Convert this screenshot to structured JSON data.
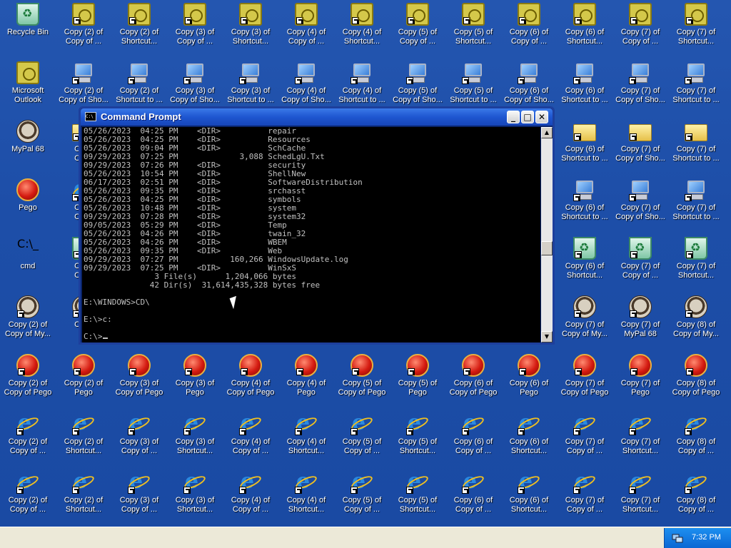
{
  "desktop": {
    "icons": [
      {
        "type": "recycle",
        "l1": "Recycle Bin",
        "l2": ""
      },
      {
        "type": "outlook",
        "l1": "Copy (2) of",
        "l2": "Copy of ..."
      },
      {
        "type": "outlook",
        "l1": "Copy (2) of",
        "l2": "Shortcut..."
      },
      {
        "type": "outlook",
        "l1": "Copy (3) of",
        "l2": "Copy of ..."
      },
      {
        "type": "outlook",
        "l1": "Copy (3) of",
        "l2": "Shortcut..."
      },
      {
        "type": "outlook",
        "l1": "Copy (4) of",
        "l2": "Copy of ..."
      },
      {
        "type": "outlook",
        "l1": "Copy (4) of",
        "l2": "Shortcut..."
      },
      {
        "type": "outlook",
        "l1": "Copy (5) of",
        "l2": "Copy of ..."
      },
      {
        "type": "outlook",
        "l1": "Copy (5) of",
        "l2": "Shortcut..."
      },
      {
        "type": "outlook",
        "l1": "Copy (6) of",
        "l2": "Copy of ..."
      },
      {
        "type": "outlook",
        "l1": "Copy (6) of",
        "l2": "Shortcut..."
      },
      {
        "type": "outlook",
        "l1": "Copy (7) of",
        "l2": "Copy of ..."
      },
      {
        "type": "outlook",
        "l1": "Copy (7) of",
        "l2": "Shortcut..."
      },
      {
        "type": "outlook",
        "l1": "Microsoft",
        "l2": "Outlook"
      },
      {
        "type": "computer",
        "l1": "Copy (2) of",
        "l2": "Copy of Sho..."
      },
      {
        "type": "computer",
        "l1": "Copy (2) of",
        "l2": "Shortcut to ..."
      },
      {
        "type": "computer",
        "l1": "Copy (3) of",
        "l2": "Copy of Sho..."
      },
      {
        "type": "computer",
        "l1": "Copy (3) of",
        "l2": "Shortcut to ..."
      },
      {
        "type": "computer",
        "l1": "Copy (4) of",
        "l2": "Copy of Sho..."
      },
      {
        "type": "computer",
        "l1": "Copy (4) of",
        "l2": "Shortcut to ..."
      },
      {
        "type": "computer",
        "l1": "Copy (5) of",
        "l2": "Copy of Sho..."
      },
      {
        "type": "computer",
        "l1": "Copy (5) of",
        "l2": "Shortcut to ..."
      },
      {
        "type": "computer",
        "l1": "Copy (6) of",
        "l2": "Copy of Sho..."
      },
      {
        "type": "computer",
        "l1": "Copy (6) of",
        "l2": "Shortcut to ..."
      },
      {
        "type": "computer",
        "l1": "Copy (7) of",
        "l2": "Copy of Sho..."
      },
      {
        "type": "computer",
        "l1": "Copy (7) of",
        "l2": "Shortcut to ..."
      },
      {
        "type": "raccoon",
        "l1": "MyPal 68",
        "l2": ""
      },
      {
        "type": "folder",
        "l1": "Copy",
        "l2": "Copy"
      },
      {
        "type": "folder",
        "l1": "Copy (6) of",
        "l2": "Shortcut to ..."
      },
      {
        "type": "folder",
        "l1": "Copy (7) of",
        "l2": "Copy of Sho..."
      },
      {
        "type": "folder",
        "l1": "Copy (7) of",
        "l2": "Shortcut to ..."
      },
      {
        "type": "pego",
        "l1": "Pego",
        "l2": ""
      },
      {
        "type": "ie",
        "l1": "Copy",
        "l2": "Copy"
      },
      {
        "type": "computer",
        "l1": "Copy (6) of",
        "l2": "Shortcut to ..."
      },
      {
        "type": "computer",
        "l1": "Copy (7) of",
        "l2": "Copy of Sho..."
      },
      {
        "type": "computer",
        "l1": "Copy (7) of",
        "l2": "Shortcut to ..."
      },
      {
        "type": "cmd",
        "l1": "cmd",
        "l2": ""
      },
      {
        "type": "recycle",
        "l1": "Copy",
        "l2": "Copy"
      },
      {
        "type": "recycle",
        "l1": "Copy (6) of",
        "l2": "Shortcut..."
      },
      {
        "type": "recycle",
        "l1": "Copy (7) of",
        "l2": "Copy of ..."
      },
      {
        "type": "recycle",
        "l1": "Copy (7) of",
        "l2": "Shortcut..."
      },
      {
        "type": "raccoon",
        "l1": "Copy (2) of",
        "l2": "Copy of My..."
      },
      {
        "type": "raccoon",
        "l1": "Copy",
        "l2": "My"
      },
      {
        "type": "raccoon",
        "l1": "Copy (7) of",
        "l2": "Copy of My..."
      },
      {
        "type": "raccoon",
        "l1": "Copy (7) of",
        "l2": "MyPal 68"
      },
      {
        "type": "raccoon",
        "l1": "Copy (8) of",
        "l2": "Copy of My..."
      },
      {
        "type": "pego",
        "l1": "Copy (2) of",
        "l2": "Copy of Pego"
      },
      {
        "type": "pego",
        "l1": "Copy (2) of",
        "l2": "Pego"
      },
      {
        "type": "pego",
        "l1": "Copy (3) of",
        "l2": "Copy of Pego"
      },
      {
        "type": "pego",
        "l1": "Copy (3) of",
        "l2": "Pego"
      },
      {
        "type": "pego",
        "l1": "Copy (4) of",
        "l2": "Copy of Pego"
      },
      {
        "type": "pego",
        "l1": "Copy (4) of",
        "l2": "Pego"
      },
      {
        "type": "pego",
        "l1": "Copy (5) of",
        "l2": "Copy of Pego"
      },
      {
        "type": "pego",
        "l1": "Copy (5) of",
        "l2": "Pego"
      },
      {
        "type": "pego",
        "l1": "Copy (6) of",
        "l2": "Copy of Pego"
      },
      {
        "type": "pego",
        "l1": "Copy (6) of",
        "l2": "Pego"
      },
      {
        "type": "pego",
        "l1": "Copy (7) of",
        "l2": "Copy of Pego"
      },
      {
        "type": "pego",
        "l1": "Copy (7) of",
        "l2": "Pego"
      },
      {
        "type": "pego",
        "l1": "Copy (8) of",
        "l2": "Copy of Pego"
      },
      {
        "type": "ie",
        "l1": "Copy (2) of",
        "l2": "Copy of ..."
      },
      {
        "type": "ie",
        "l1": "Copy (2) of",
        "l2": "Shortcut..."
      },
      {
        "type": "ie",
        "l1": "Copy (3) of",
        "l2": "Copy of ..."
      },
      {
        "type": "ie",
        "l1": "Copy (3) of",
        "l2": "Shortcut..."
      },
      {
        "type": "ie",
        "l1": "Copy (4) of",
        "l2": "Copy of ..."
      },
      {
        "type": "ie",
        "l1": "Copy (4) of",
        "l2": "Shortcut..."
      },
      {
        "type": "ie",
        "l1": "Copy (5) of",
        "l2": "Copy of ..."
      },
      {
        "type": "ie",
        "l1": "Copy (5) of",
        "l2": "Shortcut..."
      },
      {
        "type": "ie",
        "l1": "Copy (6) of",
        "l2": "Copy of ..."
      },
      {
        "type": "ie",
        "l1": "Copy (6) of",
        "l2": "Shortcut..."
      },
      {
        "type": "ie",
        "l1": "Copy (7) of",
        "l2": "Copy of ..."
      },
      {
        "type": "ie",
        "l1": "Copy (7) of",
        "l2": "Shortcut..."
      },
      {
        "type": "ie",
        "l1": "Copy (8) of",
        "l2": "Copy of ..."
      },
      {
        "type": "ie",
        "l1": "Copy (2) of",
        "l2": "Copy of ..."
      },
      {
        "type": "ie",
        "l1": "Copy (2) of",
        "l2": "Shortcut..."
      },
      {
        "type": "ie",
        "l1": "Copy (3) of",
        "l2": "Copy of ..."
      },
      {
        "type": "ie",
        "l1": "Copy (3) of",
        "l2": "Shortcut..."
      },
      {
        "type": "ie",
        "l1": "Copy (4) of",
        "l2": "Copy of ..."
      },
      {
        "type": "ie",
        "l1": "Copy (4) of",
        "l2": "Shortcut..."
      },
      {
        "type": "ie",
        "l1": "Copy (5) of",
        "l2": "Copy of ..."
      },
      {
        "type": "ie",
        "l1": "Copy (5) of",
        "l2": "Shortcut..."
      },
      {
        "type": "ie",
        "l1": "Copy (6) of",
        "l2": "Copy of ..."
      },
      {
        "type": "ie",
        "l1": "Copy (6) of",
        "l2": "Shortcut..."
      },
      {
        "type": "ie",
        "l1": "Copy (7) of",
        "l2": "Copy of ..."
      },
      {
        "type": "ie",
        "l1": "Copy (7) of",
        "l2": "Shortcut..."
      },
      {
        "type": "ie",
        "l1": "Copy (8) of",
        "l2": "Copy of ..."
      }
    ]
  },
  "cmd_window": {
    "title": "Command Prompt",
    "minimize_label": "_",
    "maximize_label": "□",
    "close_label": "✕",
    "lines": [
      "05/26/2023  04:25 PM    <DIR>          repair",
      "05/26/2023  04:25 PM    <DIR>          Resources",
      "05/26/2023  09:04 PM    <DIR>          SchCache",
      "09/29/2023  07:25 PM             3,088 SchedLgU.Txt",
      "09/29/2023  07:26 PM    <DIR>          security",
      "05/26/2023  10:54 PM    <DIR>          ShellNew",
      "06/17/2023  02:51 PM    <DIR>          SoftwareDistribution",
      "05/26/2023  09:35 PM    <DIR>          srchasst",
      "05/26/2023  04:25 PM    <DIR>          symbols",
      "05/26/2023  10:48 PM    <DIR>          system",
      "09/29/2023  07:28 PM    <DIR>          system32",
      "09/05/2023  05:29 PM    <DIR>          Temp",
      "05/26/2023  04:26 PM    <DIR>          twain_32",
      "05/26/2023  04:26 PM    <DIR>          WBEM",
      "05/26/2023  09:35 PM    <DIR>          Web",
      "09/29/2023  07:27 PM           160,266 WindowsUpdate.log",
      "09/29/2023  07:25 PM    <DIR>          WinSxS",
      "               3 File(s)      1,204,066 bytes",
      "              42 Dir(s)  31,614,435,328 bytes free",
      "",
      "E:\\WINDOWS>CD\\",
      "",
      "E:\\>c:",
      ""
    ],
    "prompt": "C:\\>"
  },
  "taskbar": {
    "clock": "7:32 PM"
  }
}
